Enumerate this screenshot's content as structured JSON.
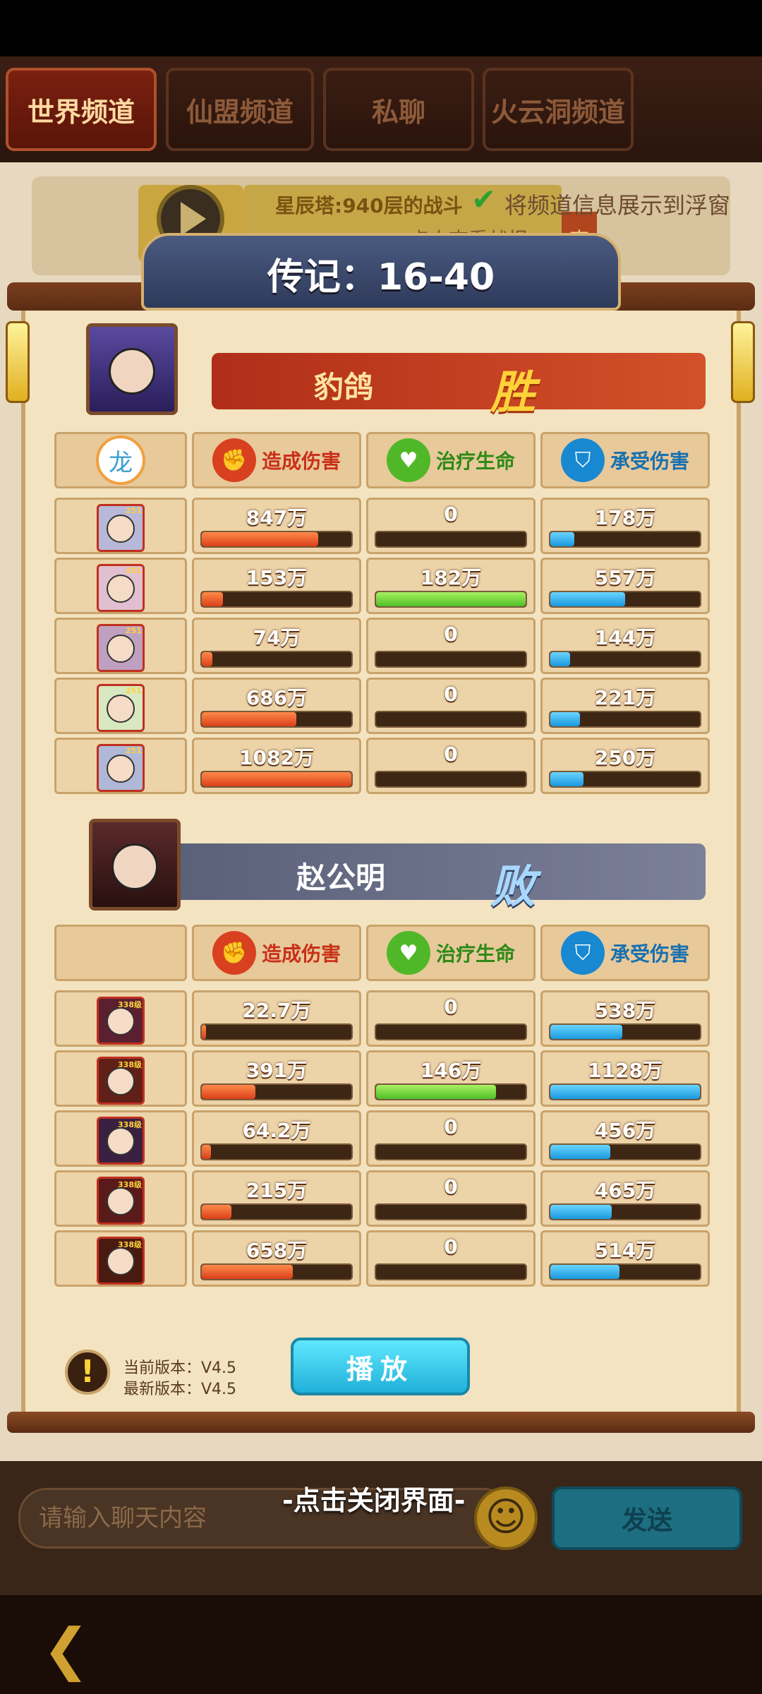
{
  "tabs": [
    {
      "label": "世界频道",
      "active": true
    },
    {
      "label": "仙盟频道",
      "active": false
    },
    {
      "label": "私聊",
      "active": false
    },
    {
      "label": "火云洞频道",
      "active": false
    }
  ],
  "top_message": {
    "title": "星辰塔:940层的战斗",
    "subtitle": "点击查看战报",
    "side_char": "李"
  },
  "float_option": {
    "label": "将频道信息展示到浮窗",
    "checked": true
  },
  "report": {
    "title": "传记：16-40",
    "headers": [
      "造成伤害",
      "治疗生命",
      "承受伤害"
    ],
    "teams": [
      {
        "name": "豹鸽",
        "result": "胜",
        "rows": [
          {
            "level": "251",
            "dmg": "847万",
            "dmg_frac": 0.78,
            "heal": "0",
            "heal_frac": 0,
            "taken": "178万",
            "taken_frac": 0.16
          },
          {
            "level": "251",
            "dmg": "153万",
            "dmg_frac": 0.14,
            "heal": "182万",
            "heal_frac": 1.0,
            "taken": "557万",
            "taken_frac": 0.5
          },
          {
            "level": "251",
            "dmg": "74万",
            "dmg_frac": 0.07,
            "heal": "0",
            "heal_frac": 0,
            "taken": "144万",
            "taken_frac": 0.13
          },
          {
            "level": "251",
            "dmg": "686万",
            "dmg_frac": 0.63,
            "heal": "0",
            "heal_frac": 0,
            "taken": "221万",
            "taken_frac": 0.2
          },
          {
            "level": "251",
            "dmg": "1082万",
            "dmg_frac": 1.0,
            "heal": "0",
            "heal_frac": 0,
            "taken": "250万",
            "taken_frac": 0.22
          }
        ]
      },
      {
        "name": "赵公明",
        "result": "败",
        "rows": [
          {
            "level": "338级",
            "dmg": "22.7万",
            "dmg_frac": 0.03,
            "heal": "0",
            "heal_frac": 0,
            "taken": "538万",
            "taken_frac": 0.48
          },
          {
            "level": "338级",
            "dmg": "391万",
            "dmg_frac": 0.36,
            "heal": "146万",
            "heal_frac": 0.8,
            "taken": "1128万",
            "taken_frac": 1.0
          },
          {
            "level": "338级",
            "dmg": "64.2万",
            "dmg_frac": 0.06,
            "heal": "0",
            "heal_frac": 0,
            "taken": "456万",
            "taken_frac": 0.4
          },
          {
            "level": "338级",
            "dmg": "215万",
            "dmg_frac": 0.2,
            "heal": "0",
            "heal_frac": 0,
            "taken": "465万",
            "taken_frac": 0.41
          },
          {
            "level": "338级",
            "dmg": "658万",
            "dmg_frac": 0.61,
            "heal": "0",
            "heal_frac": 0,
            "taken": "514万",
            "taken_frac": 0.46
          }
        ]
      }
    ],
    "version_current": "当前版本：V4.5",
    "version_latest": "最新版本：V4.5",
    "play_label": "播放"
  },
  "chat": {
    "placeholder": "请输入聊天内容",
    "close_hint": "-点击关闭界面-",
    "send_label": "发送"
  },
  "colors": {
    "damage": "#e0481e",
    "heal": "#5ccc30",
    "taken": "#1ea0e0"
  },
  "icons": [
    "play-icon",
    "check-icon",
    "fist-icon",
    "heal-heart-icon",
    "shield-icon",
    "warning-icon",
    "smiley-icon",
    "back-arrow-icon",
    "dragon-icon"
  ]
}
